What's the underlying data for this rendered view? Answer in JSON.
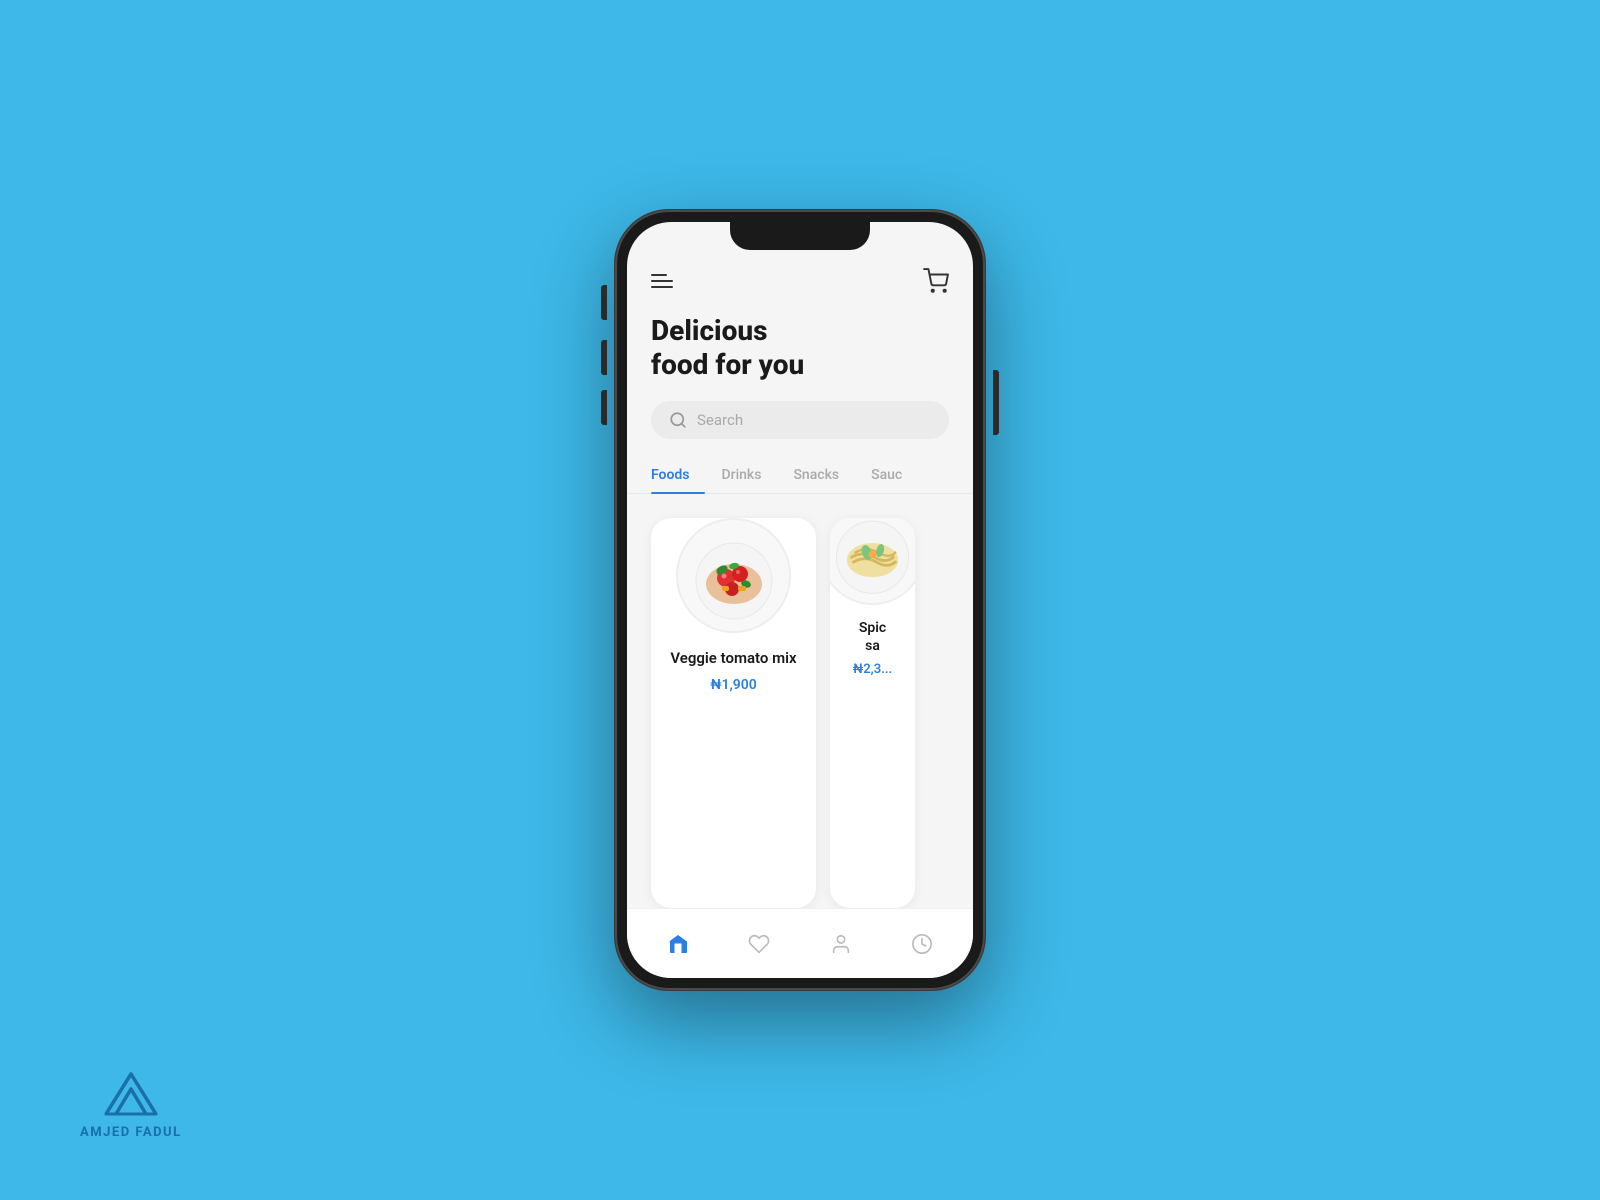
{
  "background": "#3db8e8",
  "watermark": {
    "text": "AMJED FADUL"
  },
  "app": {
    "title_line1": "Delicious",
    "title_line2": "food for you",
    "search_placeholder": "Search",
    "tabs": [
      {
        "label": "Foods",
        "active": true
      },
      {
        "label": "Drinks",
        "active": false
      },
      {
        "label": "Snacks",
        "active": false
      },
      {
        "label": "Sauc...",
        "active": false
      }
    ],
    "food_cards": [
      {
        "name": "Veggie tomato mix",
        "price": "₦1,900",
        "emoji": "🍅",
        "partial": false
      },
      {
        "name": "Spic sa",
        "price": "₦2,3...",
        "emoji": "🥗",
        "partial": true
      }
    ],
    "nav": [
      {
        "label": "Home",
        "icon": "home",
        "active": true
      },
      {
        "label": "Favorites",
        "icon": "heart",
        "active": false
      },
      {
        "label": "Profile",
        "icon": "person",
        "active": false
      },
      {
        "label": "History",
        "icon": "clock",
        "active": false
      }
    ]
  }
}
